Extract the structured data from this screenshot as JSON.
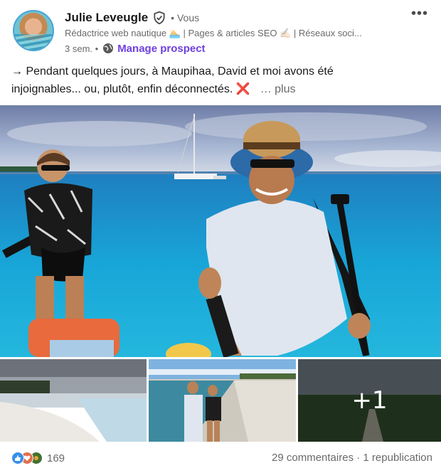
{
  "author": {
    "name": "Julie Leveugle",
    "degree": "• Vous",
    "headline": "Rédactrice web nautique 🏊 | Pages & articles SEO ✍🏻 | Réseaux soci...",
    "time": "3 sem. •",
    "manage_label": "Manage prospect"
  },
  "menu": {
    "more_label": "•••"
  },
  "post": {
    "text_line1": "→ Pendant quelques jours, à Maupihaa, David et moi avons été",
    "text_line2": "injoignables... ou, plutôt, enfin déconnectés. ",
    "cross": "❌",
    "see_more": "… plus"
  },
  "images": {
    "extra_count": "+1"
  },
  "social": {
    "reaction_count": "169",
    "comments": "29 commentaires",
    "separator": " · ",
    "reposts": "1 republication"
  },
  "colors": {
    "accent": "#6f3fe0",
    "like": "#378fe9",
    "love": "#df704d",
    "support": "#44712e"
  }
}
